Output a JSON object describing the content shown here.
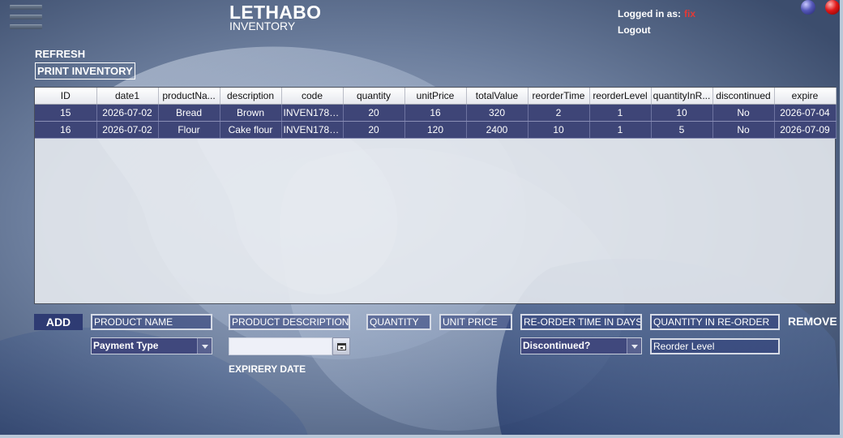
{
  "header": {
    "title": "LETHABO",
    "subtitle": "INVENTORY",
    "logged_in_label": "Logged in as:",
    "user": "fix",
    "logout": "Logout"
  },
  "actions": {
    "refresh": "REFRESH",
    "print_inventory": "PRINT INVENTORY",
    "add": "ADD",
    "remove": "REMOVE"
  },
  "table": {
    "columns": [
      "ID",
      "date1",
      "productNa...",
      "description",
      "code",
      "quantity",
      "unitPrice",
      "totalValue",
      "reorderTime",
      "reorderLevel",
      "quantityInR...",
      "discontinued",
      "expire"
    ],
    "rows": [
      [
        "15",
        "2026-07-02",
        "Bread",
        "Brown",
        "INVEN1782...",
        "20",
        "16",
        "320",
        "2",
        "1",
        "10",
        "No",
        "2026-07-04"
      ],
      [
        "16",
        "2026-07-02",
        "Flour",
        "Cake flour",
        "INVEN1782...",
        "20",
        "120",
        "2400",
        "10",
        "1",
        "5",
        "No",
        "2026-07-09"
      ]
    ]
  },
  "form": {
    "product_name": "PRODUCT NAME",
    "product_description": "PRODUCT DESCRIPTION",
    "quantity": "QUANTITY",
    "unit_price": "UNIT PRICE",
    "reorder_time": "RE-ORDER TIME IN DAYS",
    "quantity_in_reorder": "QUANTITY IN RE-ORDER",
    "payment_type": "Payment Type",
    "discontinued": "Discontinued?",
    "reorder_level": "Reorder Level",
    "expiry_label": "EXPIRERY DATE"
  }
}
